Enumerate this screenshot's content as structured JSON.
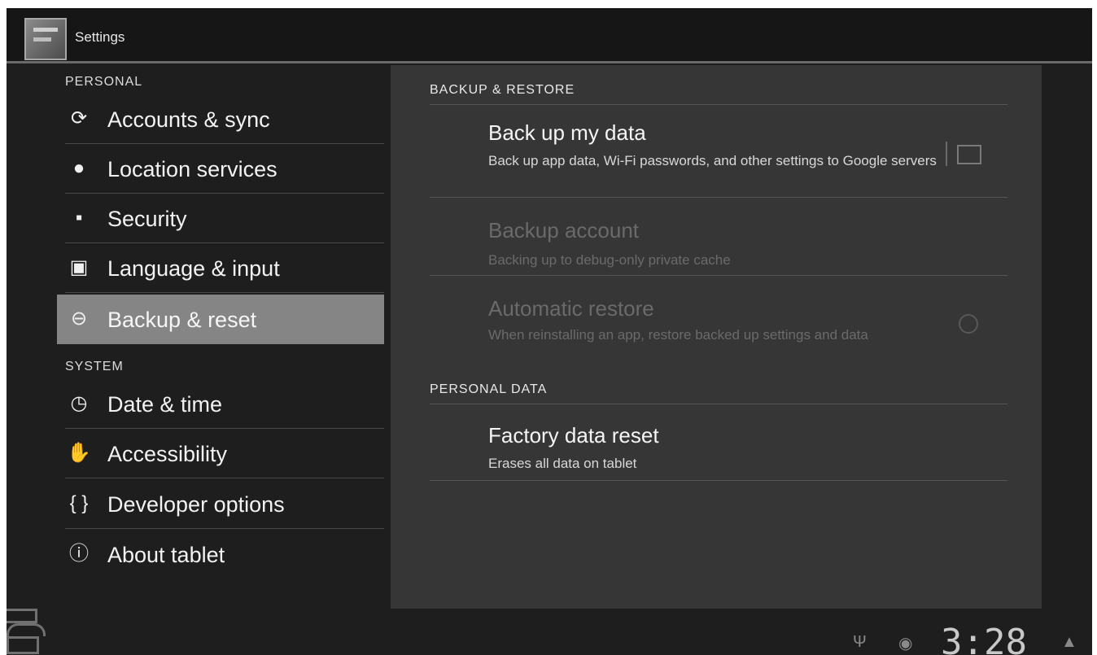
{
  "action_bar": {
    "title": "Settings",
    "icon": "settings-app-icon"
  },
  "left_pane": {
    "personal_header": "PERSONAL",
    "system_header": "SYSTEM",
    "personal_items": [
      {
        "label": "Accounts & sync",
        "icon": "sync-icon"
      },
      {
        "label": "Location services",
        "icon": "location-icon"
      },
      {
        "label": "Security",
        "icon": "lock-icon"
      },
      {
        "label": "Language & input",
        "icon": "keyboard-icon"
      },
      {
        "label": "Backup & reset",
        "icon": "backup-icon",
        "selected": true
      }
    ],
    "system_items": [
      {
        "label": "Date & time",
        "icon": "clock-icon"
      },
      {
        "label": "Accessibility",
        "icon": "hand-icon"
      },
      {
        "label": "Developer options",
        "icon": "braces-icon"
      },
      {
        "label": "About tablet",
        "icon": "info-icon"
      }
    ]
  },
  "right_pane": {
    "backup_section": "BACKUP & RESTORE",
    "backup_my_data": {
      "title": "Back up my data",
      "summary": "Back up app data, Wi-Fi passwords, and other settings to Google servers"
    },
    "backup_account": {
      "title": "Backup account",
      "summary": "Backing up to debug-only private cache"
    },
    "auto_restore": {
      "title": "Automatic restore",
      "summary": "When reinstalling an app, restore backed up settings and data"
    },
    "personal_section": "PERSONAL DATA",
    "factory_reset": {
      "title": "Factory data reset",
      "summary": "Erases all data on tablet"
    }
  },
  "status_bar": {
    "time": "3:28"
  },
  "colors": {
    "background": "#1e1e1f",
    "selected_item": "#858586",
    "detail_panel": "#363637"
  }
}
